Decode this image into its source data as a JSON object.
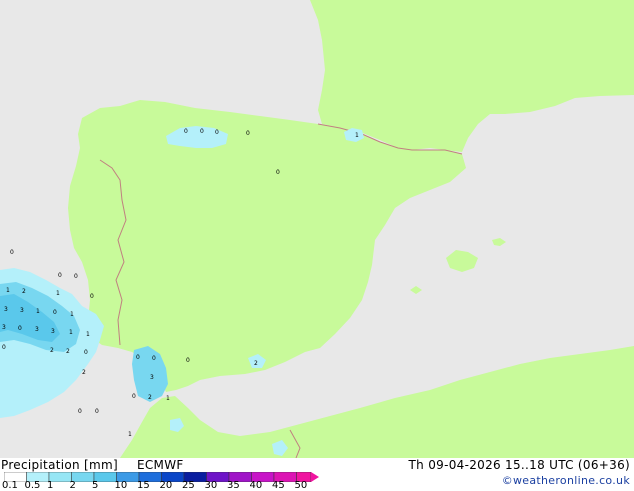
{
  "footer": {
    "title": "Precipitation [mm]",
    "model": "ECMWF",
    "valid_time": "Th 09-04-2026 15..18 UTC (06+36)",
    "credit": "©weatheronline.co.uk"
  },
  "legend": {
    "labels": [
      "0.1",
      "0.5",
      "1",
      "2",
      "5",
      "10",
      "15",
      "20",
      "25",
      "30",
      "35",
      "40",
      "45",
      "50"
    ],
    "colors": [
      "#ffffff",
      "#b4f0fa",
      "#96e6f5",
      "#78d7f0",
      "#5ac8eb",
      "#3c9ae6",
      "#1e6edc",
      "#0a46c8",
      "#0a1ea0",
      "#6e14c8",
      "#a014c8",
      "#c814c8",
      "#dc14b4",
      "#f014a0"
    ]
  },
  "map": {
    "colors": {
      "sea": "#e8e8e8",
      "land": "#c8fa9a",
      "border": "#c08080",
      "coast": "#a0a0a0",
      "precip_light": "#b4f0fa",
      "precip_mid": "#78d7f0",
      "precip_heavy": "#5ac8eb"
    },
    "values": [
      {
        "id": "v1",
        "text": "0"
      },
      {
        "id": "v2",
        "text": "0"
      },
      {
        "id": "v3",
        "text": "0"
      },
      {
        "id": "v4",
        "text": "0"
      },
      {
        "id": "v5",
        "text": "1"
      },
      {
        "id": "v6",
        "text": "0"
      },
      {
        "id": "v7",
        "text": "0"
      },
      {
        "id": "v8",
        "text": "0"
      },
      {
        "id": "v9",
        "text": "0"
      },
      {
        "id": "v10",
        "text": "0"
      },
      {
        "id": "v11",
        "text": "1"
      },
      {
        "id": "v12",
        "text": "2"
      },
      {
        "id": "v13",
        "text": "1"
      },
      {
        "id": "v14",
        "text": "3"
      },
      {
        "id": "v15",
        "text": "3"
      },
      {
        "id": "v16",
        "text": "1"
      },
      {
        "id": "v17",
        "text": "0"
      },
      {
        "id": "v18",
        "text": "1"
      },
      {
        "id": "v19",
        "text": "3"
      },
      {
        "id": "v20",
        "text": "0"
      },
      {
        "id": "v21",
        "text": "3"
      },
      {
        "id": "v22",
        "text": "3"
      },
      {
        "id": "v23",
        "text": "1"
      },
      {
        "id": "v24",
        "text": "1"
      },
      {
        "id": "v25",
        "text": "2"
      },
      {
        "id": "v26",
        "text": "2"
      },
      {
        "id": "v27",
        "text": "0"
      },
      {
        "id": "v28",
        "text": "2"
      },
      {
        "id": "v29",
        "text": "0"
      },
      {
        "id": "v30",
        "text": "0"
      },
      {
        "id": "v31",
        "text": "3"
      },
      {
        "id": "v32",
        "text": "0"
      },
      {
        "id": "v33",
        "text": "2"
      },
      {
        "id": "v34",
        "text": "1"
      },
      {
        "id": "v35",
        "text": "0"
      },
      {
        "id": "v36",
        "text": "2"
      },
      {
        "id": "v37",
        "text": "0"
      },
      {
        "id": "v38",
        "text": "0"
      },
      {
        "id": "v39",
        "text": "1"
      },
      {
        "id": "v40",
        "text": "0"
      }
    ]
  }
}
